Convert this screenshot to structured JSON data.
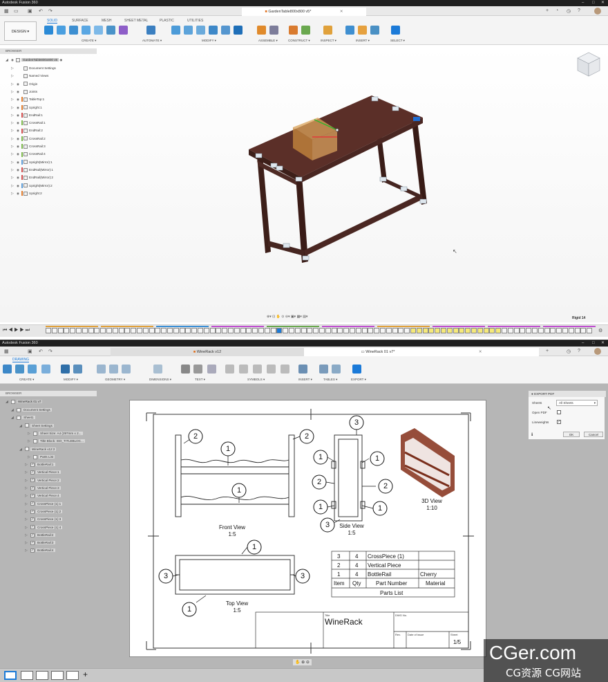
{
  "top": {
    "title": "Autodesk Fusion 360",
    "doc_tab": "GardenTable800x800 v5*",
    "workspace": "DESIGN",
    "ribbon_tabs": [
      "SOLID",
      "SURFACE",
      "MESH",
      "SHEET METAL",
      "PLASTIC",
      "UTILITIES"
    ],
    "groups": [
      "CREATE ▾",
      "AUTOMATE ▾",
      "MODIFY ▾",
      "ASSEMBLE ▾",
      "CONSTRUCT ▾",
      "INSPECT ▾",
      "INSERT ▾",
      "SELECT ▾"
    ],
    "browser_label": "BROWSER",
    "root": "GardenTable800x800 v5",
    "items": [
      "Document Settings",
      "Named Views",
      "Origin",
      "Joints",
      "TableTop:1",
      "Upright:1",
      "EndRail:1",
      "CrossRail:1",
      "EndRail:2",
      "CrossRail:2",
      "CrossRail:3",
      "CrossRail:4",
      "Upright(Mirror):1",
      "EndRail(Mirror):1",
      "EndRail(Mirror):2",
      "Upright(Mirror):2",
      "Upright:2"
    ],
    "status": "Rigid 14"
  },
  "bottom": {
    "title": "Autodesk Fusion 360",
    "tab1": "WineRack v12",
    "tab2": "WineRack 01 v7*",
    "workspace_tab": "DRAWING",
    "groups": [
      "CREATE ▾",
      "MODIFY ▾",
      "GEOMETRY ▾",
      "DIMENSIONS ▾",
      "TEXT ▾",
      "SYMBOLS ▾",
      "INSERT ▾",
      "TABLES ▾",
      "EXPORT ▾"
    ],
    "browser_label": "BROWSER",
    "root": "WineRack 01 v7",
    "items": [
      "Document Settings",
      "Sheet1",
      "Sheet Settings",
      "Sheet Size: A4 (297mm x 2...",
      "Title Block: ISO_TITLEBLOC...",
      "WineRack v12:2",
      "Parts List",
      "BottleRail:1",
      "Vertical Piece:1",
      "Vertical Piece:2",
      "Vertical Piece:3",
      "Vertical Piece:4",
      "CrossPiece (1):1",
      "CrossPiece (1):2",
      "CrossPiece (1):3",
      "CrossPiece (1):4",
      "BottleRail:2",
      "BottleRail:3",
      "BottleRail:4"
    ]
  },
  "drawing": {
    "front_view": "Front View",
    "side_view": "Side View",
    "top_view": "Top View",
    "view_3d": "3D View",
    "scale_front": "1:5",
    "scale_side": "1:5",
    "scale_top": "1:5",
    "scale_3d": "1:10",
    "parts_header": [
      "Item",
      "Qty",
      "Part Number",
      "Material"
    ],
    "parts_rows": [
      [
        "3",
        "4",
        "CrossPiece (1)",
        ""
      ],
      [
        "2",
        "4",
        "Vertical Piece",
        ""
      ],
      [
        "1",
        "4",
        "BottleRail",
        "Cherry"
      ]
    ],
    "parts_title": "Parts List",
    "tb_title_label": "Title",
    "tb_title": "WineRack",
    "tb_dwg": "DWG No.",
    "tb_rev": "Rev.",
    "tb_date": "Date of issue",
    "tb_sheet": "Sheet",
    "tb_sheet_val": "1/5"
  },
  "export_dialog": {
    "title": "EXPORT PDF",
    "sheets_label": "Sheets",
    "sheets_value": "All Sheets",
    "open_pdf": "Open PDF",
    "lineweights": "Lineweights",
    "ok": "OK",
    "cancel": "Cancel"
  },
  "watermark": {
    "main": "CGer.com",
    "sub": "CG资源 CG网站"
  }
}
